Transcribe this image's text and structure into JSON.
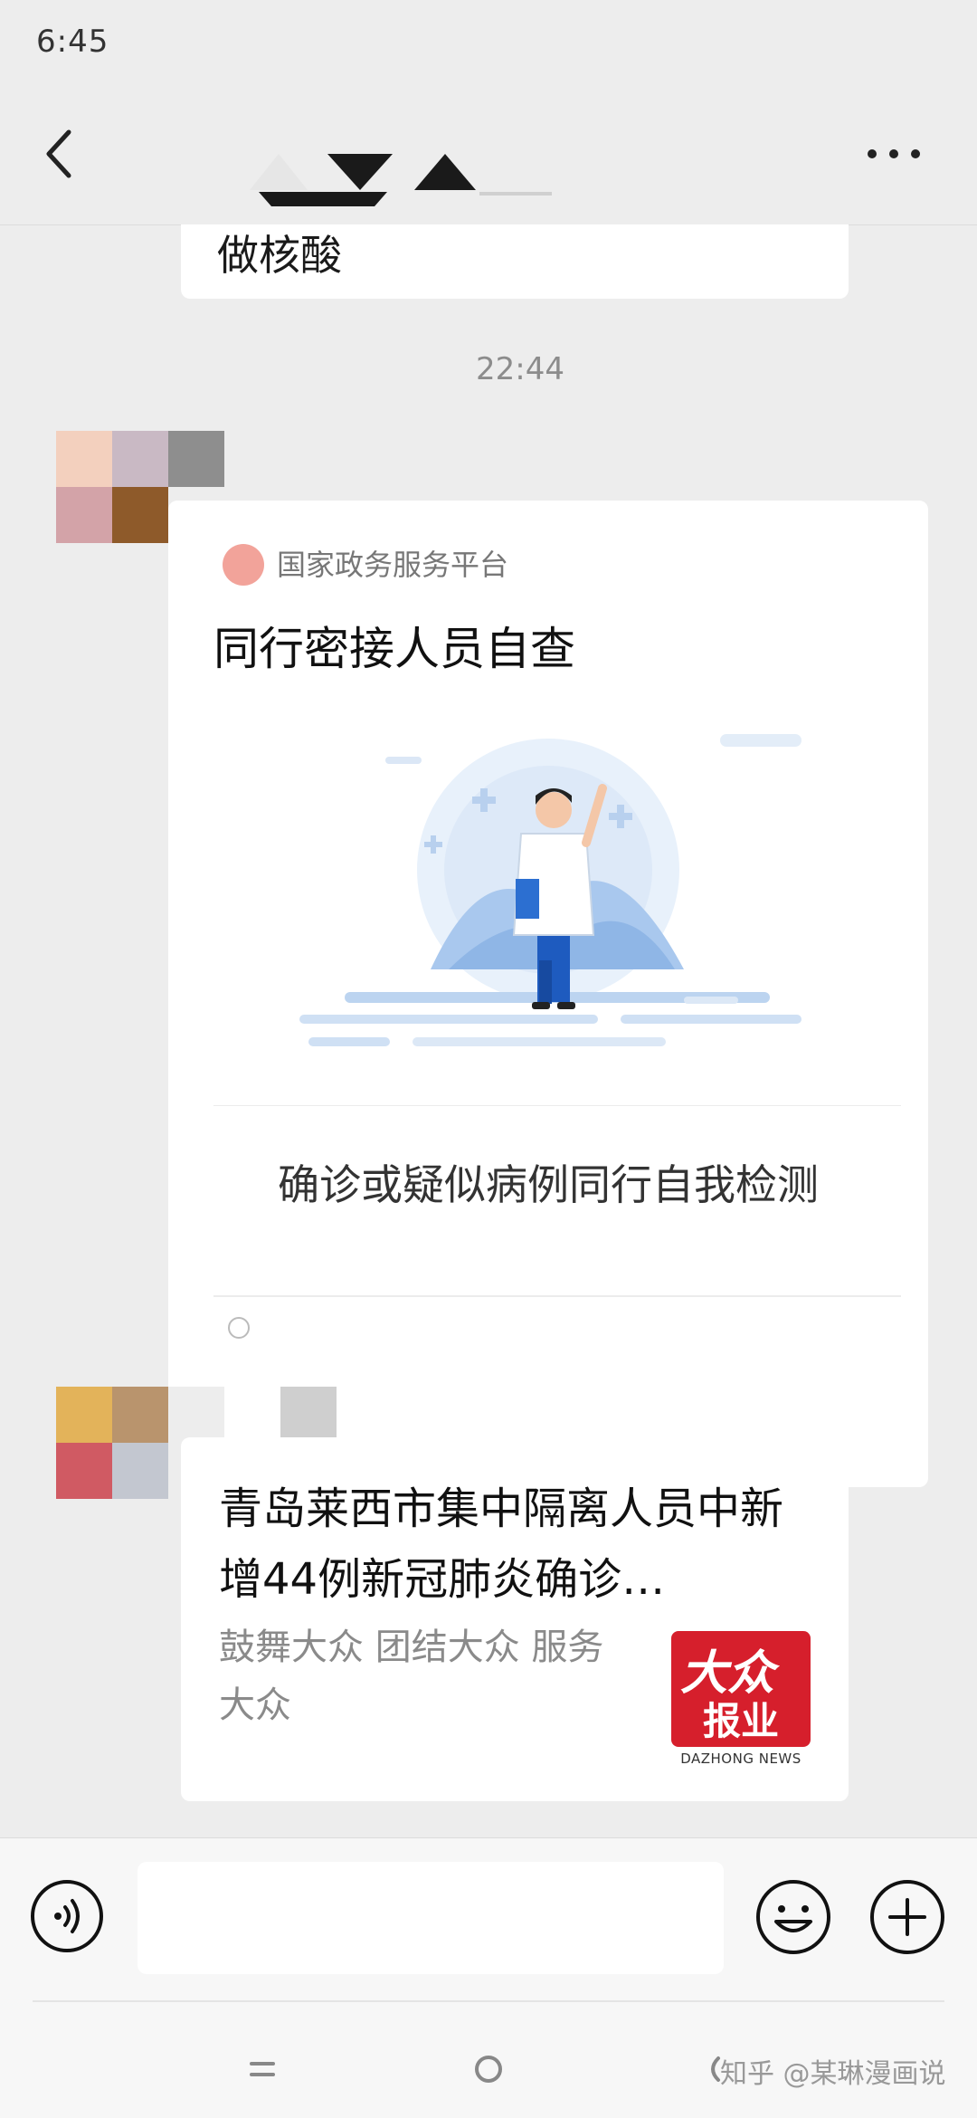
{
  "status_bar": {
    "time": "6:45"
  },
  "chat": {
    "prev_message": {
      "text": "做核酸"
    },
    "timestamp": "22:44",
    "mini_program_card": {
      "source": "国家政务服务平台",
      "title": "同行密接人员自查",
      "description": "确诊或疑似病例同行自我检测"
    },
    "news_card": {
      "title": "青岛莱西市集中隔离人员中新增44例新冠肺炎确诊…",
      "description": "鼓舞大众 团结大众 服务大众",
      "thumb_logo": "大众",
      "thumb_label": "报业",
      "thumb_en": "DAZHONG NEWS"
    }
  },
  "watermark": "知乎 @某琳漫画说",
  "colors": {
    "background": "#ededed",
    "bubble": "#ffffff",
    "news_logo_red": "#d61f2c"
  },
  "icons": [
    "back-arrow-icon",
    "more-icon",
    "voice-icon",
    "emoji-icon",
    "plus-icon",
    "nav-menu-icon",
    "nav-home-icon",
    "nav-back-icon"
  ]
}
